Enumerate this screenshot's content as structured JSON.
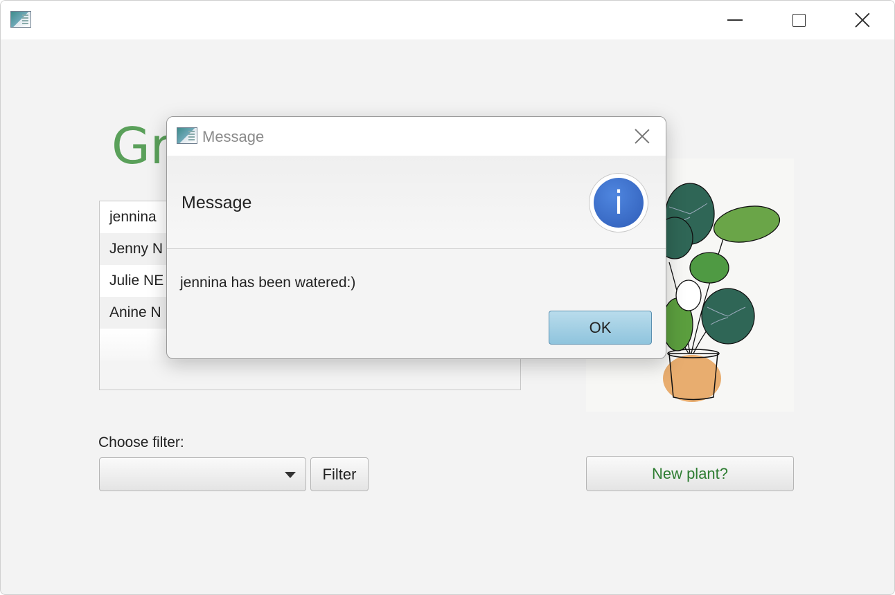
{
  "window": {
    "title_icon": "app-icon",
    "controls": [
      "minimize-icon",
      "maximize-icon",
      "close-icon"
    ]
  },
  "app": {
    "title": "Gre"
  },
  "plant_list": {
    "items": [
      "jennina",
      "Jenny N",
      "Julie NE",
      "Anine N"
    ]
  },
  "filter": {
    "label": "Choose filter:",
    "selected_value": "",
    "button_label": "Filter"
  },
  "new_plant_button": "New plant?",
  "dialog": {
    "title": "Message",
    "header": "Message",
    "content": "jennina has been watered:)",
    "ok_label": "OK",
    "icon": "info-icon",
    "icon_glyph": "i"
  },
  "colors": {
    "title_green": "#5aa05a",
    "new_plant_text": "#2e7d32",
    "ok_button": "#a7d1e6",
    "info_blue": "#3a6fcf"
  }
}
